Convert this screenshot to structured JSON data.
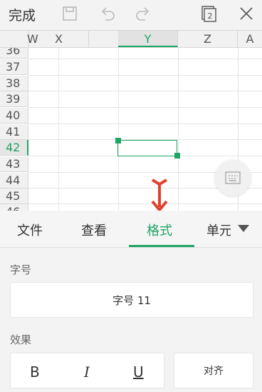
{
  "toolbar": {
    "done_label": "完成",
    "page_count": "2"
  },
  "sheet": {
    "columns": [
      "W",
      "X",
      "Y",
      "Z",
      "A"
    ],
    "selected_column": "Y",
    "rows": [
      "36",
      "37",
      "38",
      "39",
      "40",
      "41",
      "42",
      "43",
      "44",
      "45",
      "46"
    ],
    "selected_row": "42"
  },
  "tabs": [
    {
      "label": "文件"
    },
    {
      "label": "查看"
    },
    {
      "label": "格式",
      "active": true
    },
    {
      "label": "单元"
    }
  ],
  "panel": {
    "font_size_section": "字号",
    "font_size_value": "字号  11",
    "effects_section": "效果",
    "bold_label": "B",
    "italic_label": "I",
    "underline_label": "U",
    "align_label": "对齐"
  },
  "colors": {
    "accent": "#1fa465",
    "arrow": "#e0412f"
  },
  "icons": [
    "save-icon",
    "undo-icon",
    "redo-icon",
    "pages-icon",
    "close-icon",
    "keyboard-icon",
    "down-arrow-icon",
    "chevron-down-icon"
  ]
}
